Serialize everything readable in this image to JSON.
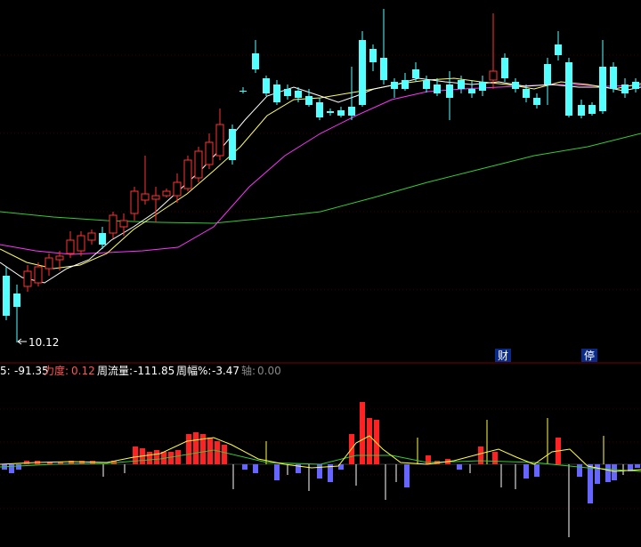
{
  "chart_data": [
    {
      "type": "candlestick",
      "title": "",
      "low_annotation": "10.12",
      "event_markers": [
        "财",
        "停"
      ],
      "colors": {
        "up": "#ff3333",
        "down": "#54ffff",
        "ma_white": "#ffffff",
        "ma_yellow": "#ffff66",
        "ma_magenta": "#ff33ff",
        "ma_green": "#33cc33",
        "marker_bg": "#0a2a8a"
      }
    },
    {
      "type": "bar",
      "indicator_values": {
        "v1": "-91.35",
        "lidu_label": "力度:",
        "lidu_value": "0.12",
        "zhouliuliang_label": "周流量:",
        "zhouliuliang_value": "-111.85",
        "zhoufu_label": "周幅%:",
        "zhoufu_value": "-3.47",
        "zhou_label": "轴:",
        "zhou_value": "0.00",
        "v1_prefix": "5:"
      },
      "colors": {
        "positive": "#ff2222",
        "negative": "#6666ff",
        "spike": "#ffffff",
        "spike_yellow": "#ffff44",
        "line": "#ffff44",
        "line2": "#33cc33"
      }
    }
  ]
}
